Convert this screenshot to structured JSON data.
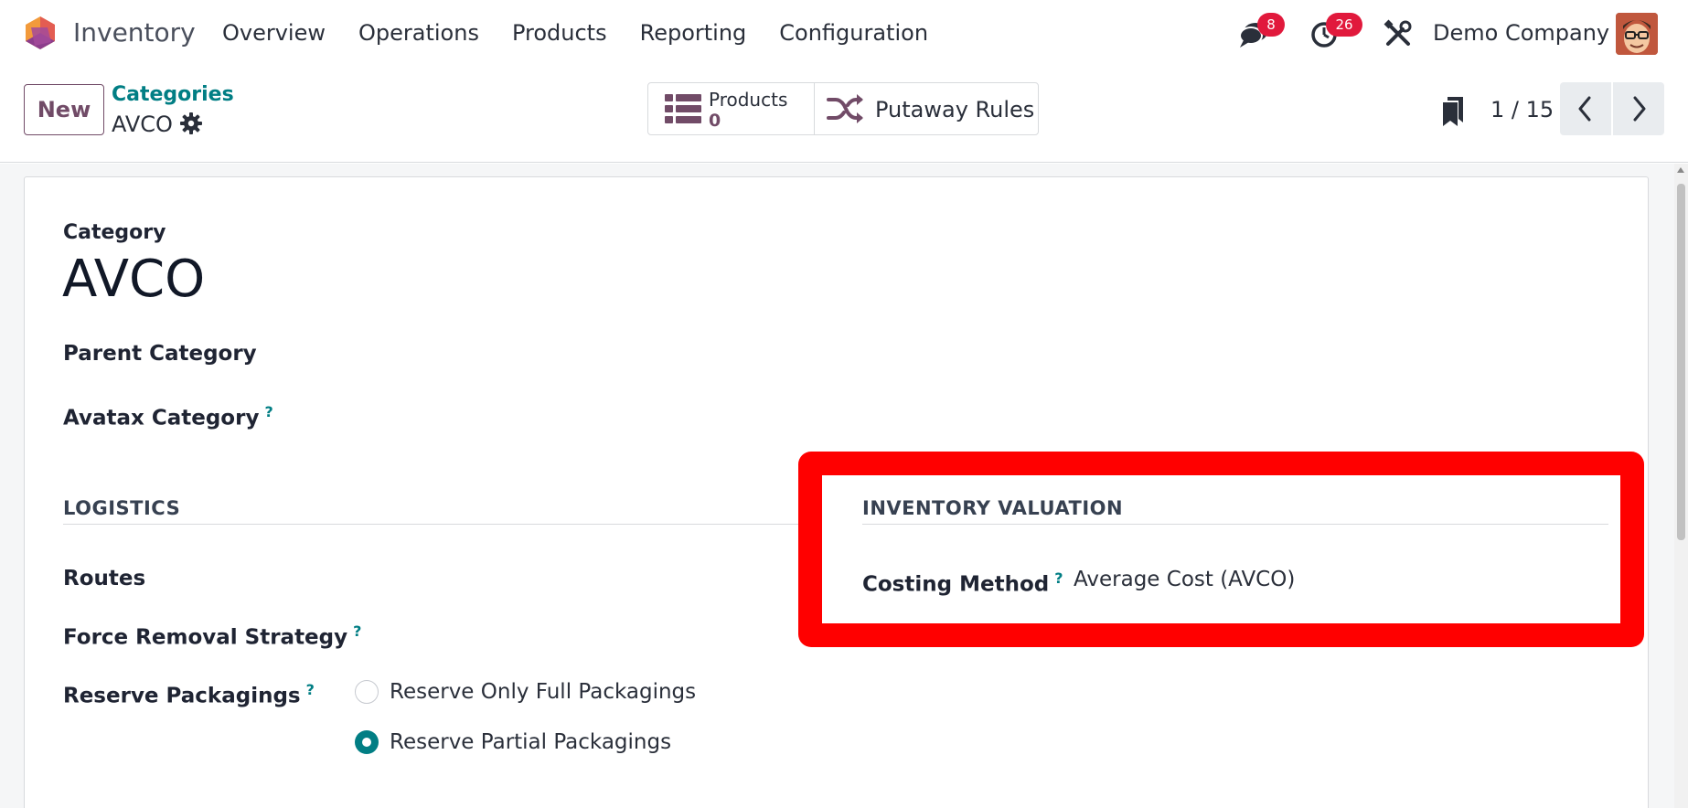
{
  "navbar": {
    "app_name": "Inventory",
    "menu": [
      "Overview",
      "Operations",
      "Products",
      "Reporting",
      "Configuration"
    ],
    "messages_badge": "8",
    "activities_badge": "26",
    "company": "Demo Company"
  },
  "control_panel": {
    "new_label": "New",
    "breadcrumb": "Categories",
    "record_name": "AVCO",
    "smart_buttons": {
      "products_label": "Products",
      "products_value": "0",
      "putaway_label": "Putaway Rules"
    },
    "pager": "1 / 15"
  },
  "form": {
    "category_label": "Category",
    "category_name": "AVCO",
    "parent_category_label": "Parent Category",
    "avatax_category_label": "Avatax Category",
    "help_mark": "?",
    "logistics": {
      "title": "LOGISTICS",
      "routes_label": "Routes",
      "force_removal_label": "Force Removal Strategy",
      "reserve_packagings_label": "Reserve Packagings",
      "reserve_options": [
        {
          "label": "Reserve Only Full Packagings",
          "checked": false
        },
        {
          "label": "Reserve Partial Packagings",
          "checked": true
        }
      ]
    },
    "inventory_valuation": {
      "title": "INVENTORY VALUATION",
      "costing_method_label": "Costing Method",
      "costing_method_value": "Average Cost (AVCO)"
    }
  },
  "colors": {
    "brand": "#714b67",
    "accent": "#017e84",
    "badge": "#e1193c",
    "highlight": "#ff0000"
  }
}
